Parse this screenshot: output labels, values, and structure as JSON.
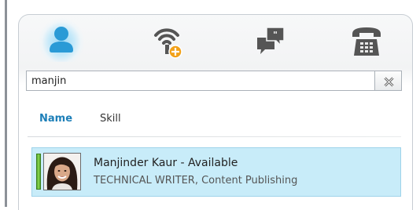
{
  "toolbar": {
    "icons": [
      "person-contacts-icon",
      "wireless-presence-icon",
      "chat-bubbles-icon",
      "desk-phone-icon"
    ],
    "accent": "#1d7fb8"
  },
  "search": {
    "value": "manjin",
    "clear_icon": "clear-x-icon"
  },
  "tabs": {
    "name_label": "Name",
    "skill_label": "Skill"
  },
  "result": {
    "name": "Manjinder Kaur",
    "separator": " - ",
    "status": "Available",
    "subtitle": "TECHNICAL WRITER, Content Publishing",
    "status_color": "#6bc13a",
    "highlight_color": "#c8ecf9"
  }
}
